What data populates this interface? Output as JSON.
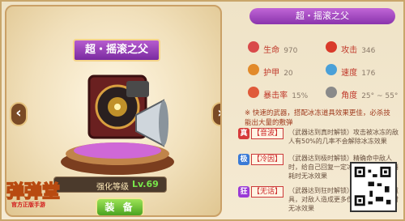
{
  "weapon": {
    "name": "超・摇滚之父",
    "level_label": "强化等级",
    "level_value": "Lv.69",
    "equip_label": "装 备"
  },
  "logo": {
    "text": "弹弹堂",
    "sub": "官方正版手游"
  },
  "stats_panel": {
    "title": "超・摇滚之父",
    "stats": [
      {
        "label": "生命",
        "value": "970",
        "color": "#d94a4a"
      },
      {
        "label": "攻击",
        "value": "346",
        "color": "#d93a2a"
      },
      {
        "label": "护甲",
        "value": "20",
        "color": "#e28a2a"
      },
      {
        "label": "速度",
        "value": "176",
        "color": "#4aa0d8"
      },
      {
        "label": "暴击率",
        "value": "15%",
        "color": "#e05a3a"
      },
      {
        "label": "角度",
        "value": "25° ~ 55°",
        "color": "#8a8a8a"
      }
    ],
    "description": "※ 快速的武器，搭配冰冻道具效果更佳，必杀技能出大量的敷弹",
    "skills": [
      {
        "tag": "真",
        "tag_color": "#d63a3a",
        "name": "【音波】",
        "desc": "（武器达到真时解锁）攻击被冰冻的敌人有50%的几率不会解除冰冻效果"
      },
      {
        "tag": "极",
        "tag_color": "#3a7ad6",
        "name": "【冷因】",
        "desc": "（武器达到极时解锁）精确命中敌人时，给自己回复一定冰冻道具，道具消耗时无冰效果"
      },
      {
        "tag": "狂",
        "tag_color": "#9a3ad6",
        "name": "【无话】",
        "desc": "（武器达到狂时解锁）消耗身上冰冻道具，对敌人造成更多伤害，道具消耗时无冰效果"
      }
    ]
  }
}
